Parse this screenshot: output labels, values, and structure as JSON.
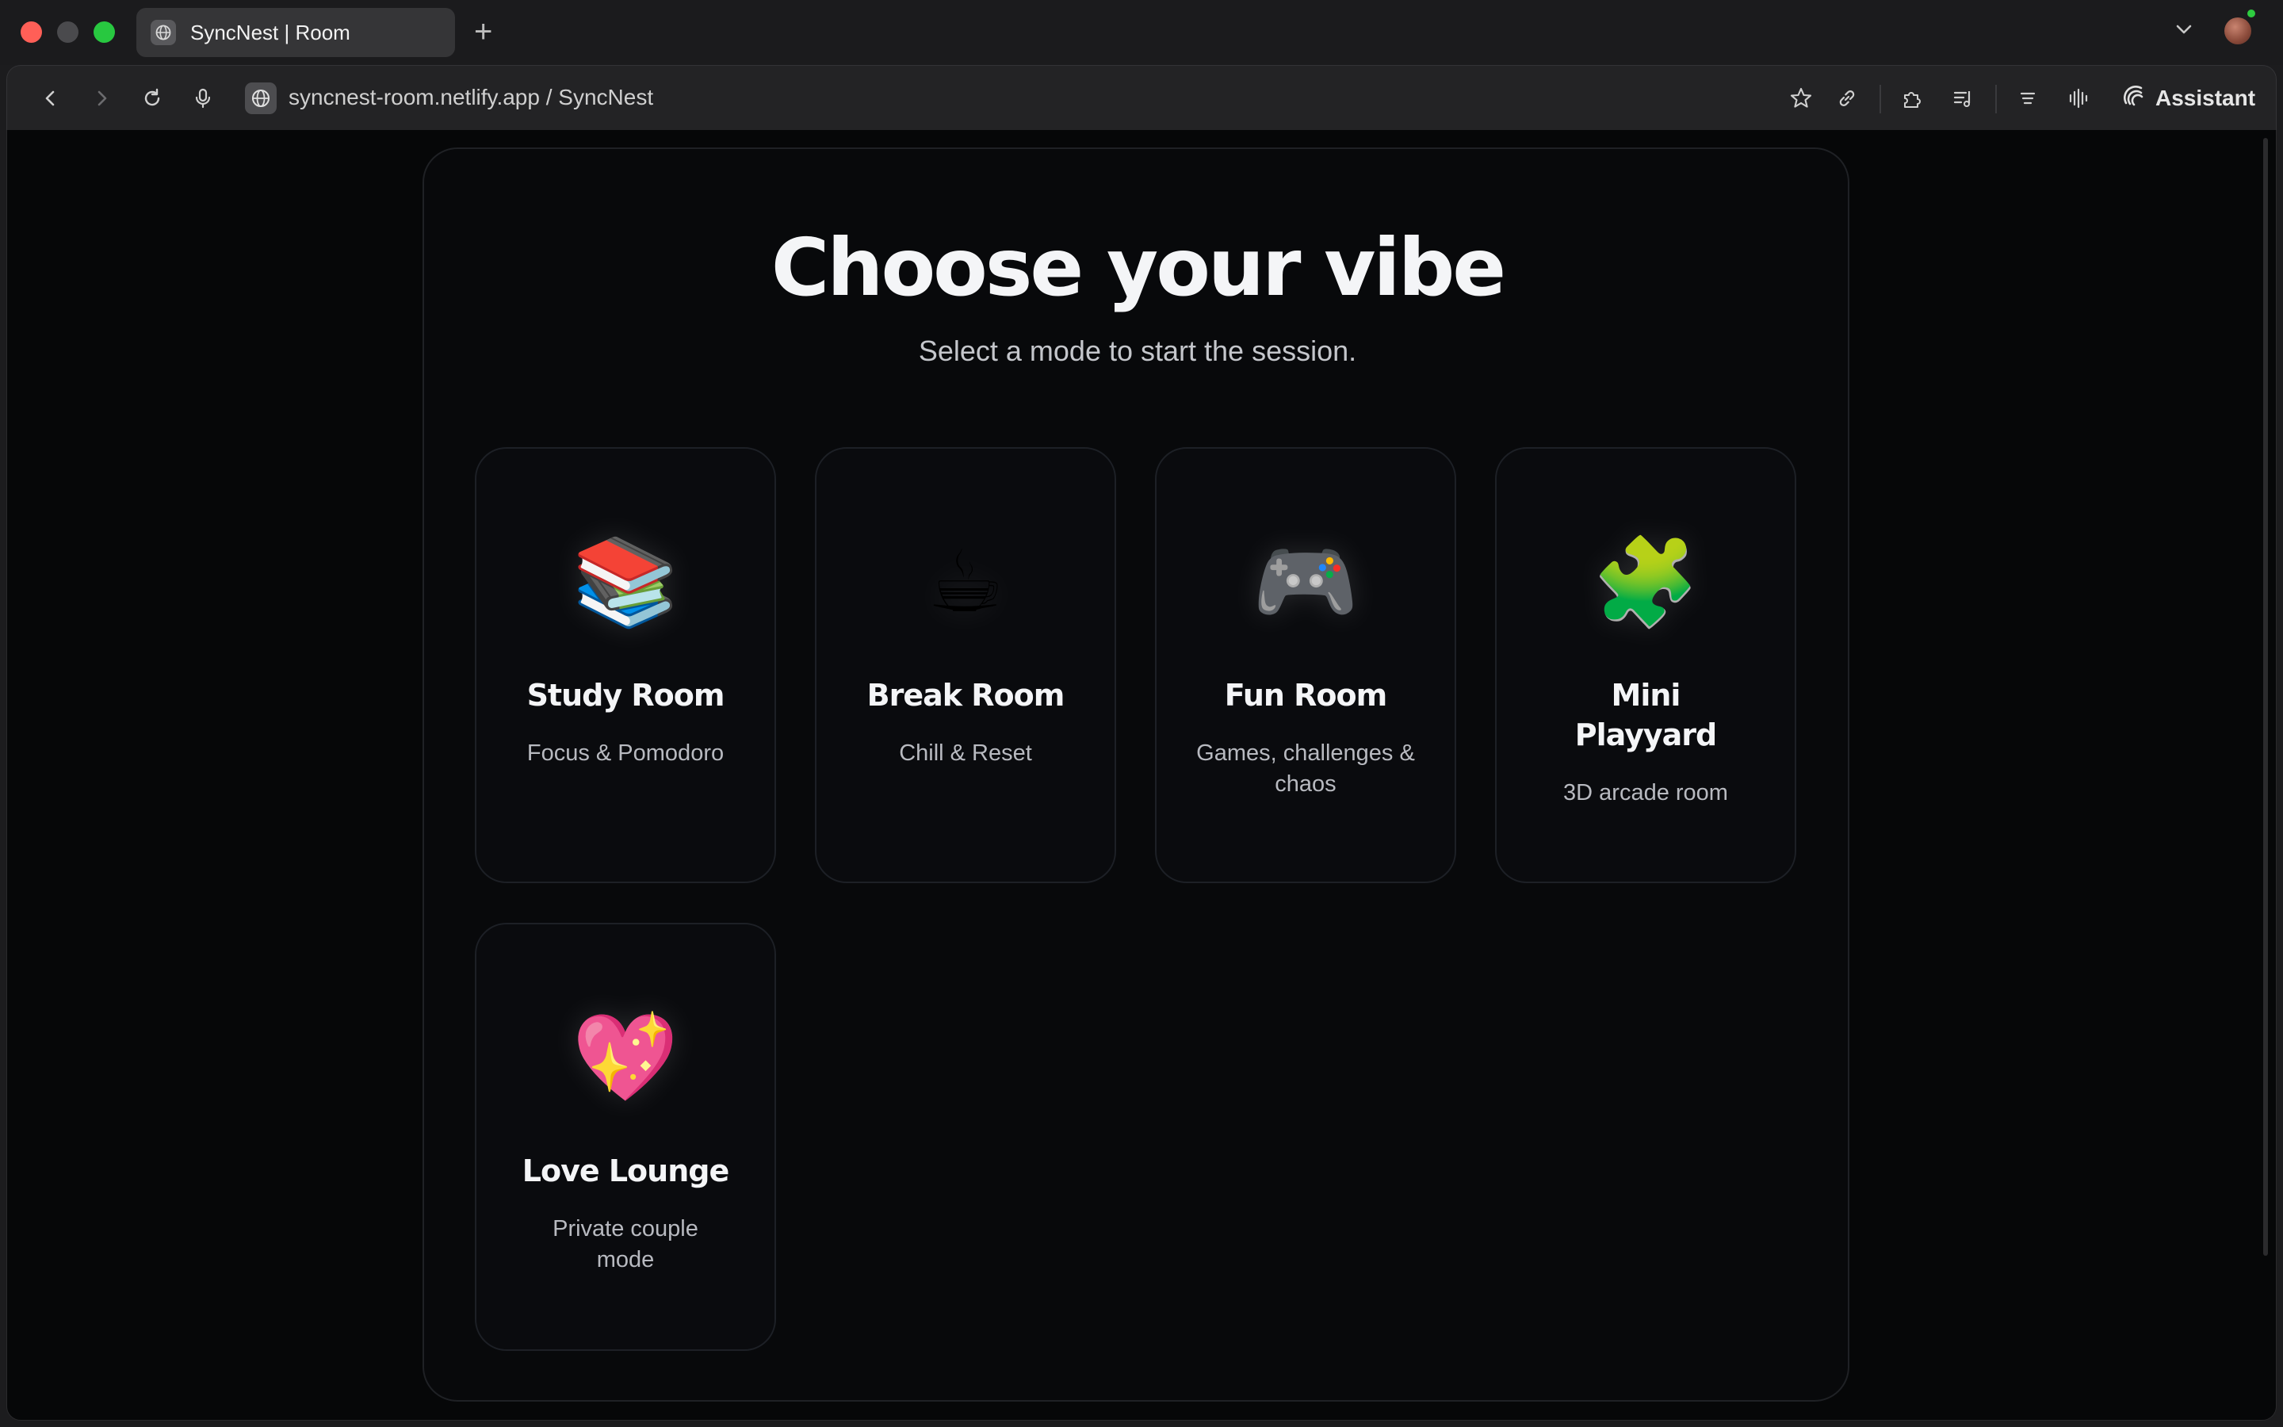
{
  "browser": {
    "tab_title": "SyncNest | Room",
    "new_tab_symbol": "+",
    "address": "syncnest-room.netlify.app / SyncNest",
    "assistant_label": "Assistant",
    "icons": [
      "back-icon",
      "forward-icon",
      "reload-icon",
      "microphone-icon",
      "globe-icon",
      "star-icon",
      "link-icon",
      "extensions-icon",
      "playlist-icon",
      "menu-lines-icon",
      "audio-wave-icon",
      "assistant-icon",
      "chevron-down-icon"
    ]
  },
  "page": {
    "title": "Choose your vibe",
    "subtitle": "Select a mode to start the session.",
    "modes": [
      {
        "emoji": "📚",
        "title": "Study Room",
        "description": "Focus & Pomodoro"
      },
      {
        "emoji": "☕",
        "title": "Break Room",
        "description": "Chill & Reset"
      },
      {
        "emoji": "🎮",
        "title": "Fun Room",
        "description": "Games, challenges & chaos"
      },
      {
        "emoji": "🧩",
        "title": "Mini Playyard",
        "description": "3D arcade room"
      },
      {
        "emoji": "💖",
        "title": "Love Lounge",
        "description": "Private couple mode"
      }
    ]
  },
  "colors": {
    "page_background": "#060708",
    "card_border": "#1d2026",
    "heading": "#f4f5f7",
    "muted_text": "#b8bac0"
  }
}
